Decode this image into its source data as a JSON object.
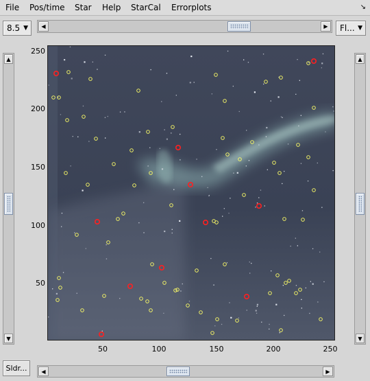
{
  "menu": [
    "File",
    "Pos/time",
    "Star",
    "Help",
    "StarCal",
    "Errorplots"
  ],
  "menu_corner_icon": "restore-icon",
  "toolbar": {
    "magnitude_value": "8.5",
    "filter_value": "Fl..."
  },
  "sliders": {
    "top_position": 0.72,
    "bottom_position": 0.47,
    "left_position": 0.52,
    "right_position": 0.52
  },
  "plot": {
    "y_ticks": [
      "250",
      "200",
      "150",
      "100",
      "50"
    ],
    "x_ticks": [
      "50",
      "100",
      "150",
      "200",
      "250"
    ]
  },
  "bottom": {
    "sldr_label": "Sldr..."
  },
  "colors": {
    "sky_background": "#3d4456",
    "aurora": "#8fb4b4",
    "catalog_marker": "#ffff66",
    "calibration_marker": "#ff2020"
  }
}
